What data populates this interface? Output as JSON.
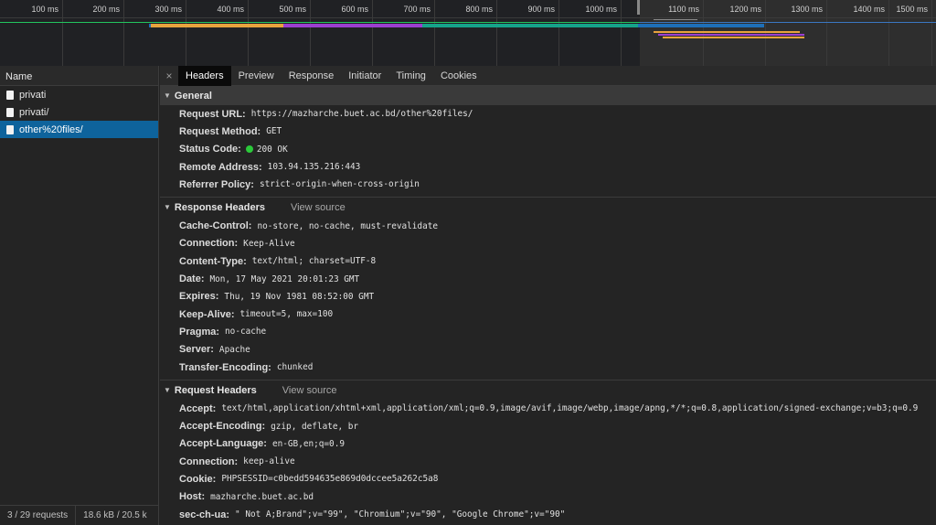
{
  "overview": {
    "ticks": [
      "100 ms",
      "200 ms",
      "300 ms",
      "400 ms",
      "500 ms",
      "600 ms",
      "700 ms",
      "800 ms",
      "900 ms",
      "1000 ms",
      "1100 ms",
      "1200 ms",
      "1300 ms",
      "1400 ms",
      "1500 ms"
    ]
  },
  "list": {
    "header": "Name",
    "items": [
      {
        "label": "privati",
        "selected": false
      },
      {
        "label": "privati/",
        "selected": false
      },
      {
        "label": "other%20files/",
        "selected": true
      }
    ],
    "requests_count": "3 / 29 requests",
    "transferred": "18.6 kB / 20.5 k"
  },
  "tabs": {
    "close": "×",
    "items": [
      "Headers",
      "Preview",
      "Response",
      "Initiator",
      "Timing",
      "Cookies"
    ],
    "active": "Headers"
  },
  "general": {
    "title": "General",
    "rows": [
      {
        "key": "Request URL:",
        "value": "https://mazharche.buet.ac.bd/other%20files/"
      },
      {
        "key": "Request Method:",
        "value": "GET"
      },
      {
        "key": "Status Code:",
        "value": "200 OK",
        "status_dot": "#2bc93a"
      },
      {
        "key": "Remote Address:",
        "value": "103.94.135.216:443"
      },
      {
        "key": "Referrer Policy:",
        "value": "strict-origin-when-cross-origin"
      }
    ]
  },
  "response_headers": {
    "title": "Response Headers",
    "view_source": "View source",
    "rows": [
      {
        "key": "Cache-Control:",
        "value": "no-store, no-cache, must-revalidate"
      },
      {
        "key": "Connection:",
        "value": "Keep-Alive"
      },
      {
        "key": "Content-Type:",
        "value": "text/html; charset=UTF-8"
      },
      {
        "key": "Date:",
        "value": "Mon, 17 May 2021 20:01:23 GMT"
      },
      {
        "key": "Expires:",
        "value": "Thu, 19 Nov 1981 08:52:00 GMT"
      },
      {
        "key": "Keep-Alive:",
        "value": "timeout=5, max=100"
      },
      {
        "key": "Pragma:",
        "value": "no-cache"
      },
      {
        "key": "Server:",
        "value": "Apache"
      },
      {
        "key": "Transfer-Encoding:",
        "value": "chunked"
      }
    ]
  },
  "request_headers": {
    "title": "Request Headers",
    "view_source": "View source",
    "rows": [
      {
        "key": "Accept:",
        "value": "text/html,application/xhtml+xml,application/xml;q=0.9,image/avif,image/webp,image/apng,*/*;q=0.8,application/signed-exchange;v=b3;q=0.9"
      },
      {
        "key": "Accept-Encoding:",
        "value": "gzip, deflate, br"
      },
      {
        "key": "Accept-Language:",
        "value": "en-GB,en;q=0.9"
      },
      {
        "key": "Connection:",
        "value": "keep-alive"
      },
      {
        "key": "Cookie:",
        "value": "PHPSESSID=c0bedd594635e869d0dccee5a262c5a8"
      },
      {
        "key": "Host:",
        "value": "mazharche.buet.ac.bd"
      },
      {
        "key": "sec-ch-ua:",
        "value": "\" Not A;Brand\";v=\"99\", \"Chromium\";v=\"90\", \"Google Chrome\";v=\"90\""
      }
    ]
  },
  "colors": {
    "selected_row": "#0e639c",
    "waterfall": [
      "#e8a33d",
      "#9b3fd0",
      "#16a38a",
      "#1e6fb8",
      "#22c55e"
    ]
  }
}
